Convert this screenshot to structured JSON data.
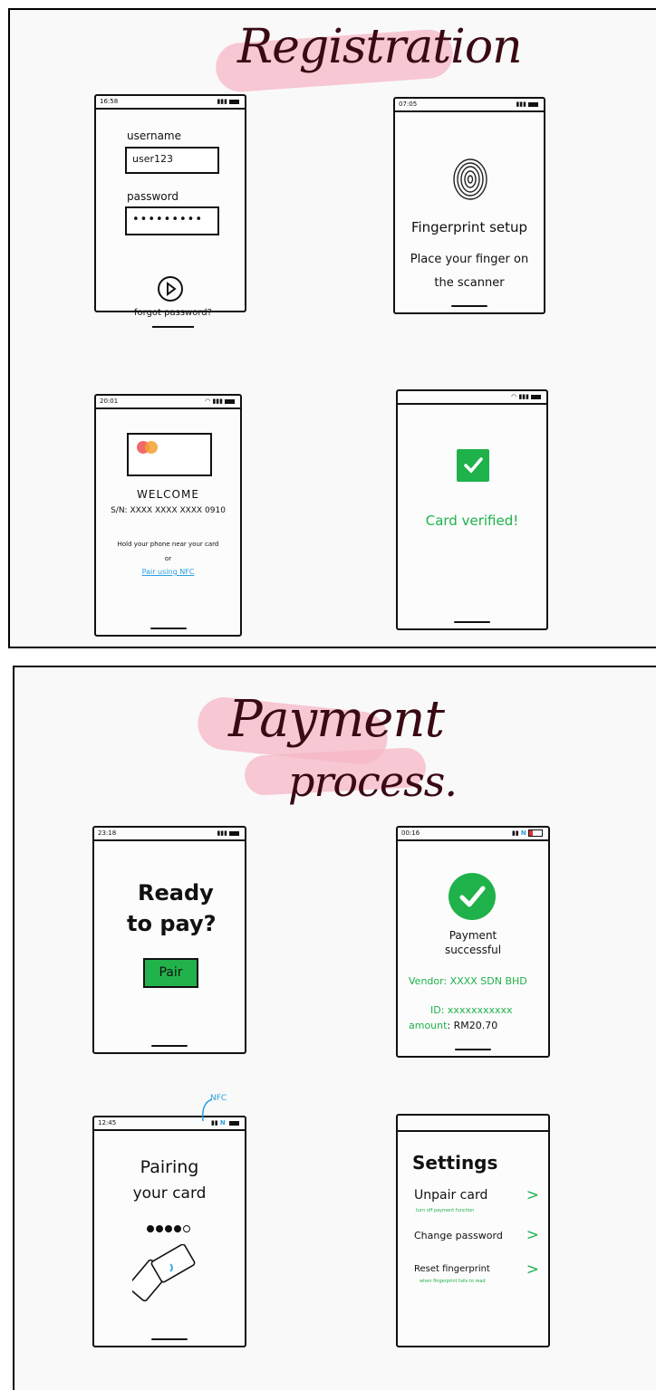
{
  "registration": {
    "title": "Registration",
    "login": {
      "time": "16:58",
      "username_label": "username",
      "username_value": "user123",
      "password_label": "password",
      "password_value": "•••••••••",
      "forgot_label": "forgot password?"
    },
    "fingerprint": {
      "time": "07:05",
      "line1": "Fingerprint setup",
      "line2": "Place your finger on",
      "line3": "the scanner"
    },
    "welcome": {
      "time": "20:01",
      "heading": "WELCOME",
      "serial": "S/N: XXXX XXXX XXXX 0910",
      "hint": "Hold your phone near your card",
      "or": "or",
      "nfc_link": "Pair using NFC"
    },
    "verified": {
      "message": "Card verified!"
    }
  },
  "payment": {
    "title_line1": "Payment",
    "title_line2": "process.",
    "ready": {
      "time": "23:18",
      "line1": "Ready",
      "line2": "to pay?",
      "button": "Pair"
    },
    "success": {
      "time": "00:16",
      "nfc_badge": "N",
      "heading_line1": "Payment",
      "heading_line2": "successful",
      "vendor_label": "Vendor",
      "vendor_value": ": XXXX SDN BHD",
      "id_label": "ID",
      "id_value": ": xxxxxxxxxxx",
      "amount_label": "amount",
      "amount_value": ": RM20.70"
    },
    "pairing": {
      "time": "12:45",
      "nfc_callout": "NFC",
      "nfc_badge": "N",
      "line1": "Pairing",
      "line2": "your card",
      "progress_filled": 4,
      "progress_total": 5
    },
    "settings": {
      "heading": "Settings",
      "items": [
        {
          "label": "Unpair card",
          "note": "turn off payment function"
        },
        {
          "label": "Change password",
          "note": ""
        },
        {
          "label": "Reset fingerprint",
          "note": "when fingerprint fails to read"
        }
      ]
    }
  },
  "colors": {
    "accent_green": "#1fb24a",
    "highlight_pink": "#f6b6c6",
    "title_ink": "#3a0a14",
    "link_blue": "#2aa0e0"
  }
}
